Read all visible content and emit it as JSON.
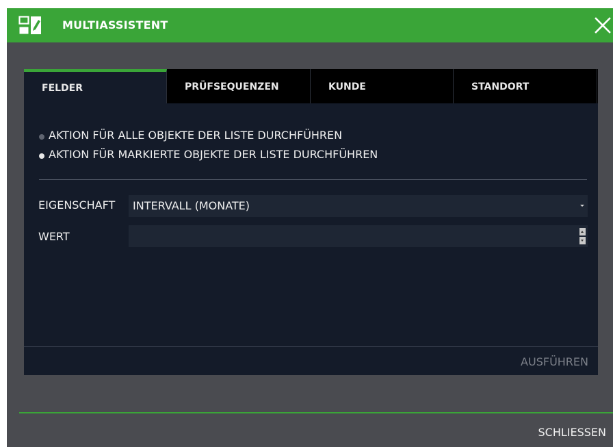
{
  "window": {
    "title": "MULTIASSISTENT",
    "icon": "multi-edit-icon",
    "close_icon": "close-icon"
  },
  "tabs": [
    {
      "label": "FELDER",
      "active": true
    },
    {
      "label": "PRÜFSEQUENZEN",
      "active": false
    },
    {
      "label": "KUNDE",
      "active": false
    },
    {
      "label": "STANDORT",
      "active": false
    }
  ],
  "radio_options": [
    {
      "label": "AKTION FÜR ALLE OBJEKTE DER LISTE DURCHFÜHREN",
      "selected": false
    },
    {
      "label": "AKTION FÜR MARKIERTE OBJEKTE DER LISTE DURCHFÜHREN",
      "selected": true
    }
  ],
  "form": {
    "property_label": "EIGENSCHAFT",
    "property_value": "INTERVALL (MONATE)",
    "value_label": "WERT",
    "value": ""
  },
  "actions": {
    "execute_label": "AUSFÜHREN",
    "close_label": "SCHLIESSEN"
  },
  "colors": {
    "accent": "#3aa538",
    "window_bg": "#4a4b50",
    "panel_bg": "#141b29",
    "field_bg": "#1e2634",
    "disabled_text": "#7d818a"
  }
}
